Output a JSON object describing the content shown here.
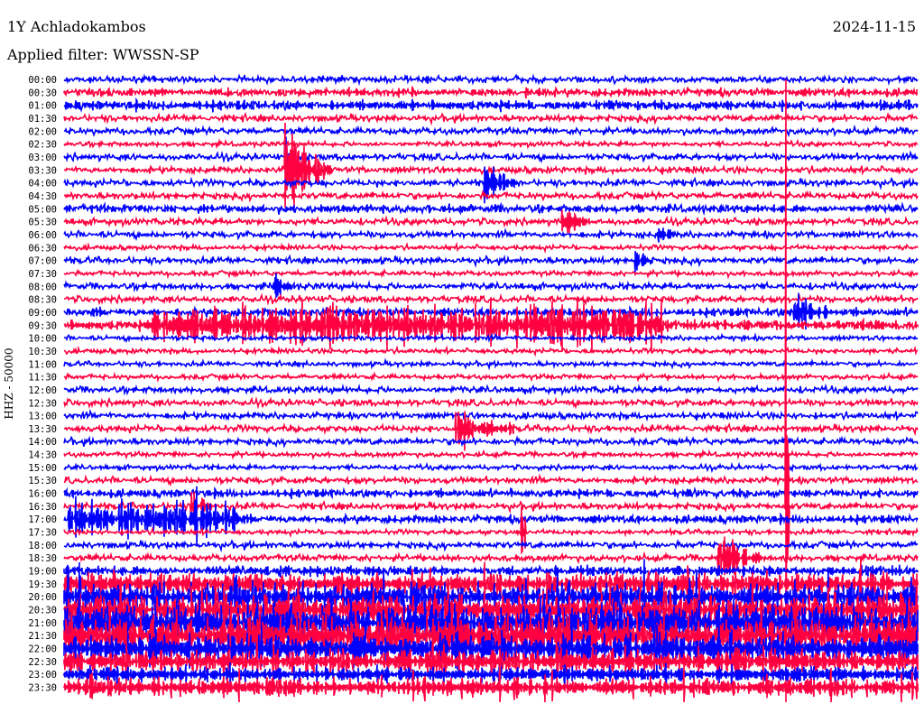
{
  "header": {
    "station": "1Y Achladokambos",
    "date": "2024-11-15",
    "filter": "Applied filter: WWSSN-SP"
  },
  "chart_data": {
    "type": "line",
    "title": "1Y Achladokambos",
    "ylabel": "HHZ - 50000",
    "xlabel": "",
    "minutes_per_line": 30,
    "row_labels": [
      "00:00",
      "00:30",
      "01:00",
      "01:30",
      "02:00",
      "02:30",
      "03:00",
      "03:30",
      "04:00",
      "04:30",
      "05:00",
      "05:30",
      "06:00",
      "06:30",
      "07:00",
      "07:30",
      "08:00",
      "08:30",
      "09:00",
      "09:30",
      "10:00",
      "10:30",
      "11:00",
      "11:30",
      "12:00",
      "12:30",
      "13:00",
      "13:30",
      "14:00",
      "14:30",
      "15:00",
      "15:30",
      "16:00",
      "16:30",
      "17:00",
      "17:30",
      "18:00",
      "18:30",
      "19:00",
      "19:30",
      "20:00",
      "20:30",
      "21:00",
      "21:30",
      "22:00",
      "22:30",
      "23:00",
      "23:30"
    ],
    "series_colors": [
      "#0000ff",
      "#ff0040"
    ],
    "noise_levels": [
      2,
      2.5,
      3,
      2,
      2,
      1.5,
      2,
      2,
      2,
      2,
      2.5,
      2,
      2,
      1.5,
      2,
      1.5,
      2,
      2,
      2.5,
      3,
      1.5,
      1.5,
      1.5,
      1.5,
      2,
      2,
      2,
      2,
      2,
      1.5,
      1.5,
      2,
      2.5,
      2,
      2.5,
      1.5,
      2,
      2,
      3,
      7,
      9,
      10,
      12,
      12,
      9,
      7,
      5,
      6
    ],
    "events": [
      {
        "row": 7,
        "minute": 7.8,
        "amp": 38,
        "duration": 1.6
      },
      {
        "row": 6,
        "minute": 7.8,
        "amp": 10,
        "duration": 0.3
      },
      {
        "row": 8,
        "minute": 14.8,
        "amp": 14,
        "duration": 1.2
      },
      {
        "row": 11,
        "minute": 17.5,
        "amp": 12,
        "duration": 1.0
      },
      {
        "row": 12,
        "minute": 20.9,
        "amp": 8,
        "duration": 0.6
      },
      {
        "row": 14,
        "minute": 20.1,
        "amp": 10,
        "duration": 0.6
      },
      {
        "row": 16,
        "minute": 7.4,
        "amp": 8,
        "duration": 0.7
      },
      {
        "row": 18,
        "minute": 25.7,
        "amp": 22,
        "duration": 1.2
      },
      {
        "row": 19,
        "minute": 3.0,
        "amp": 14,
        "duration": 18
      },
      {
        "row": 27,
        "minute": 13.8,
        "amp": 16,
        "duration": 2.0
      },
      {
        "row": 33,
        "minute": 4.5,
        "amp": 14,
        "duration": 0.8
      },
      {
        "row": 34,
        "minute": 0.2,
        "amp": 14,
        "duration": 6
      },
      {
        "row": 37,
        "minute": 23.0,
        "amp": 22,
        "duration": 1.5
      },
      {
        "row": 35,
        "minute": 16.1,
        "amp": 60,
        "duration": 0.15
      },
      {
        "row": 33,
        "minute": 25.4,
        "amp": 200,
        "duration": 0.08
      }
    ]
  }
}
